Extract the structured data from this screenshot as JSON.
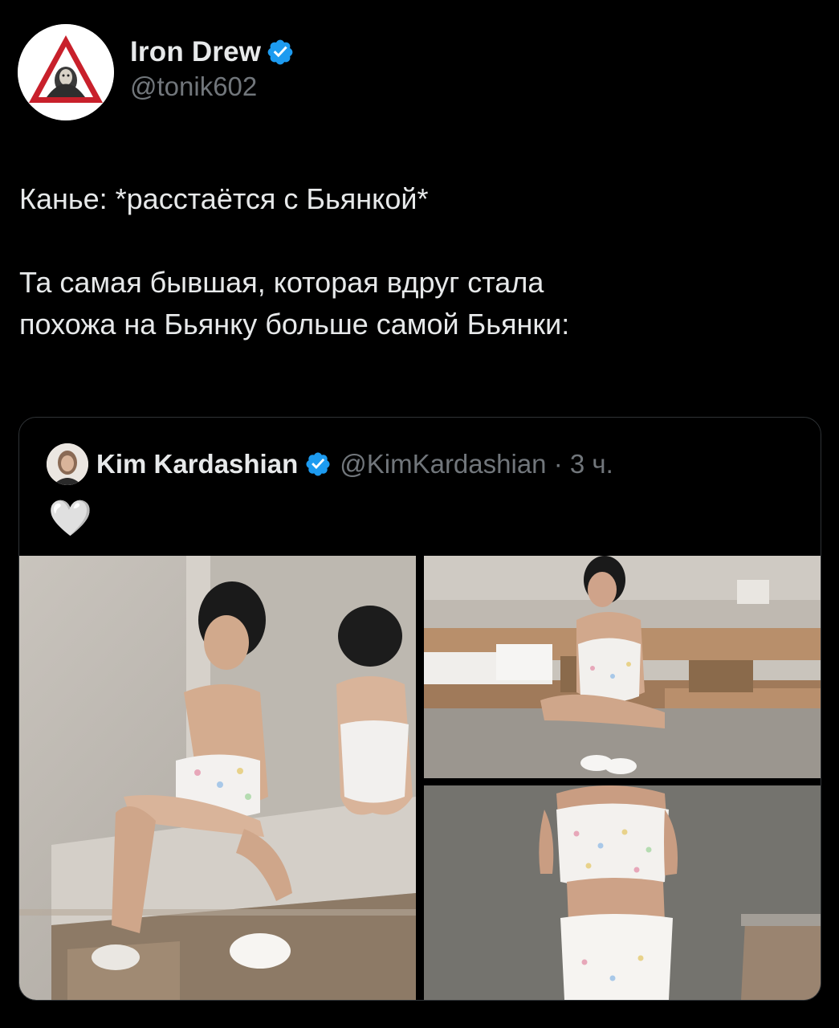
{
  "tweet": {
    "author": {
      "display_name": "Iron Drew",
      "handle": "@tonik602",
      "verified": true,
      "avatar_icon": "warning-sign-avatar-icon"
    },
    "text_line_1": "Канье: *расстаётся с Бьянкой*",
    "text_line_2": "Та самая бывшая, которая вдруг стала",
    "text_line_3": "похожа на Бьянку больше самой Бьянки:"
  },
  "quote": {
    "display_name": "Kim Kardashian",
    "handle_time": "@KimKardashian · 3 ч.",
    "verified": true,
    "text": "🤍",
    "photos": [
      "photo-left",
      "photo-top-right",
      "photo-bottom-right"
    ]
  },
  "colors": {
    "background": "#000000",
    "text_primary": "#e7e9ea",
    "text_secondary": "#71767b",
    "verified_blue": "#1d9bf0",
    "border": "#2f3336"
  }
}
